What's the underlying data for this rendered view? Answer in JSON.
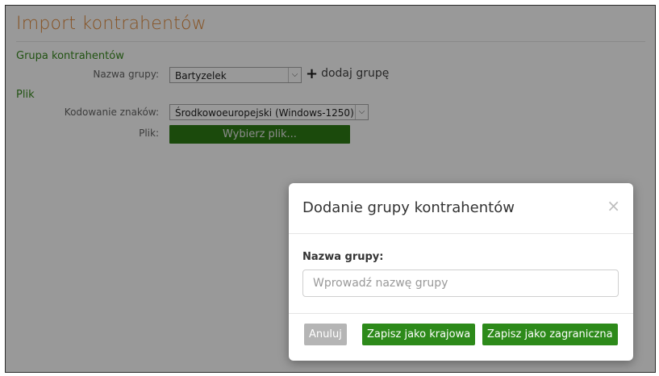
{
  "page": {
    "title": "Import kontrahentów",
    "group_section": "Grupa kontrahentów",
    "group_name_label": "Nazwa grupy:",
    "group_select_value": "Bartyzelek",
    "add_group_label": "dodaj grupę",
    "file_section": "Plik",
    "encoding_label": "Kodowanie znaków:",
    "encoding_select_value": "Środkowoeuropejski (Windows-1250)",
    "file_label": "Plik:",
    "choose_file_button": "Wybierz plik..."
  },
  "modal": {
    "title": "Dodanie grupy kontrahentów",
    "close": "×",
    "field_label": "Nazwa grupy:",
    "field_placeholder": "Wprowadź nazwę grupy",
    "cancel": "Anuluj",
    "save_domestic": "Zapisz jako krajowa",
    "save_foreign": "Zapisz jako zagraniczna"
  }
}
